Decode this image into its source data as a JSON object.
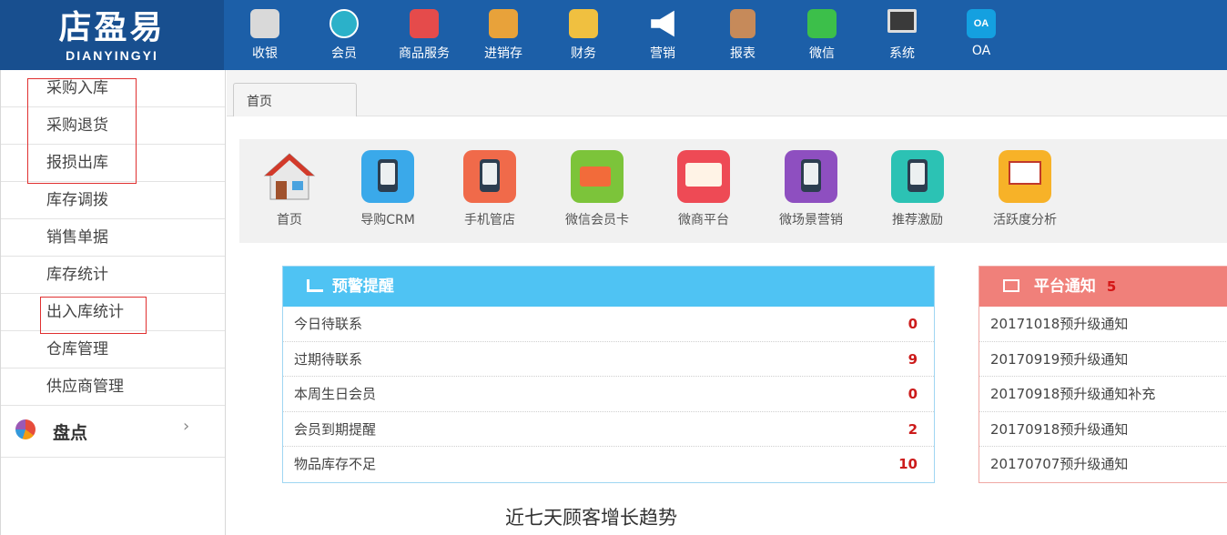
{
  "logo": {
    "text_cn": "店盈易",
    "text_en": "DIANYINGYI"
  },
  "top_nav": [
    {
      "label": "收银",
      "icon": "cash-register-icon",
      "color": "#d9d9d9"
    },
    {
      "label": "会员",
      "icon": "member-icon",
      "color": "#2bb1c9"
    },
    {
      "label": "商品服务",
      "icon": "product-service-icon",
      "color": "#e54b4b"
    },
    {
      "label": "进销存",
      "icon": "inventory-icon",
      "color": "#e8a23a"
    },
    {
      "label": "财务",
      "icon": "finance-icon",
      "color": "#f0c040"
    },
    {
      "label": "营销",
      "icon": "megaphone-icon",
      "color": "#ffffff"
    },
    {
      "label": "报表",
      "icon": "report-icon",
      "color": "#c68a5a"
    },
    {
      "label": "微信",
      "icon": "wechat-icon",
      "color": "#3cbf4a"
    },
    {
      "label": "系统",
      "icon": "monitor-icon",
      "color": "#3a3a3a"
    },
    {
      "label": "OA",
      "icon": "oa-icon",
      "icon_text": "OA",
      "color": "#14a0e0"
    }
  ],
  "sidebar": {
    "items": [
      {
        "label": "采购入库"
      },
      {
        "label": "采购退货"
      },
      {
        "label": "报损出库"
      },
      {
        "label": "库存调拨"
      },
      {
        "label": "销售单据"
      },
      {
        "label": "库存统计"
      },
      {
        "label": "出入库统计"
      },
      {
        "label": "仓库管理"
      },
      {
        "label": "供应商管理"
      }
    ],
    "group": {
      "label": "盘点",
      "chevron": "›"
    }
  },
  "tabs": [
    {
      "label": "首页"
    }
  ],
  "quick_access": [
    {
      "label": "首页",
      "icon": "house-icon",
      "color": "#ffffff"
    },
    {
      "label": "导购CRM",
      "icon": "crm-phone-icon",
      "color": "#3aa9ea"
    },
    {
      "label": "手机管店",
      "icon": "mobile-shop-icon",
      "color": "#f06a4a"
    },
    {
      "label": "微信会员卡",
      "icon": "member-card-icon",
      "color": "#7cc43a"
    },
    {
      "label": "微商平台",
      "icon": "micro-store-icon",
      "color": "#ee4a55"
    },
    {
      "label": "微场景营销",
      "icon": "scene-marketing-icon",
      "color": "#8e4fc0"
    },
    {
      "label": "推荐激励",
      "icon": "referral-icon",
      "color": "#2cc2b4"
    },
    {
      "label": "活跃度分析",
      "icon": "activity-chart-icon",
      "color": "#f7b228"
    }
  ],
  "alert_panel": {
    "title": "预警提醒",
    "icon": "factory-icon",
    "header_color": "#4fc3f3",
    "rows": [
      {
        "label": "今日待联系",
        "value": "0"
      },
      {
        "label": "过期待联系",
        "value": "9"
      },
      {
        "label": "本周生日会员",
        "value": "0"
      },
      {
        "label": "会员到期提醒",
        "value": "2"
      },
      {
        "label": "物品库存不足",
        "value": "10"
      }
    ]
  },
  "notice_panel": {
    "title": "平台通知",
    "count": "5",
    "icon": "presentation-icon",
    "header_color": "#f0807a",
    "rows": [
      {
        "label": "20171018预升级通知"
      },
      {
        "label": "20170919预升级通知"
      },
      {
        "label": "20170918预升级通知补充"
      },
      {
        "label": "20170918预升级通知"
      },
      {
        "label": "20170707预升级通知"
      }
    ]
  },
  "trend": {
    "title": "近七天顾客增长趋势"
  }
}
